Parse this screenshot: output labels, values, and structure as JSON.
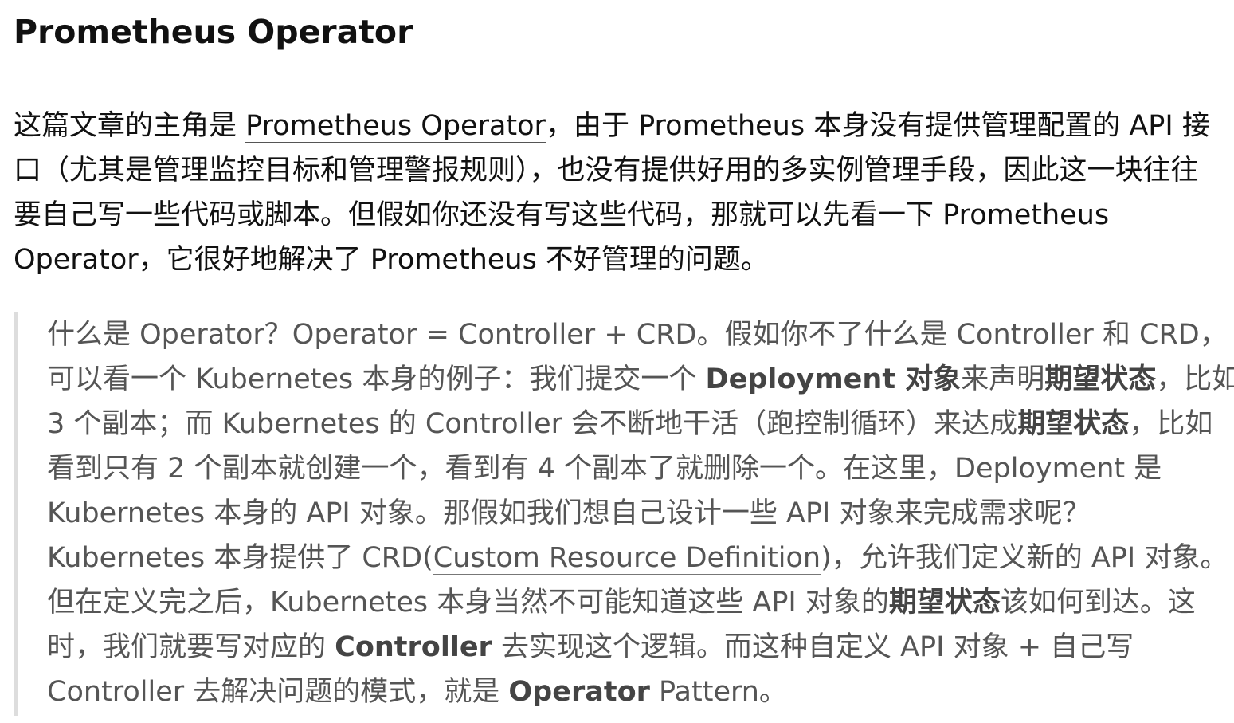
{
  "heading": "Prometheus Operator",
  "intro": {
    "line1_pre": "这篇文章的主角是 ",
    "line1_link": "Prometheus Operator",
    "line1_post": "，由于 Prometheus 本身没有提供管理配置的 API 接",
    "line2": "口（尤其是管理监控目标和管理警报规则），也没有提供好用的多实例管理手段，因此这一块往往",
    "line3": "要自己写一些代码或脚本。但假如你还没有写这些代码，那就可以先看一下 Prometheus",
    "line4": "Operator，它很好地解决了 Prometheus 不好管理的问题。"
  },
  "quote": {
    "l1": "什么是 Operator？Operator = Controller + CRD。假如你不了什么是 Controller 和 CRD，",
    "l2_a": "可以看一个 Kubernetes 本身的例子：我们提交一个 ",
    "l2_b": "Deployment 对象",
    "l2_c": "来声明",
    "l2_d": "期望状态",
    "l2_e": "，比如",
    "l3_a": "3 个副本；而 Kubernetes 的 Controller 会不断地干活（跑控制循环）来达成",
    "l3_b": "期望状态",
    "l3_c": "，比如",
    "l4": "看到只有 2 个副本就创建一个，看到有 4 个副本了就删除一个。在这里，Deployment 是",
    "l5": "Kubernetes 本身的 API 对象。那假如我们想自己设计一些 API 对象来完成需求呢？",
    "l6_a": "Kubernetes 本身提供了 CRD(",
    "l6_link": "Custom Resource Definition",
    "l6_b": ")，允许我们定义新的 API 对象。",
    "l7_a": "但在定义完之后，Kubernetes 本身当然不可能知道这些 API 对象的",
    "l7_b": "期望状态",
    "l7_c": "该如何到达。这",
    "l8_a": "时，我们就要写对应的 ",
    "l8_b": "Controller",
    "l8_c": " 去实现这个逻辑。而这种自定义 API 对象 + 自己写",
    "l9_a": "Controller 去解决问题的模式，就是 ",
    "l9_b": "Operator",
    "l9_c": " Pattern。"
  },
  "colors": {
    "text": "#111111",
    "quote_text": "#555555",
    "quote_border": "#dddddd"
  }
}
